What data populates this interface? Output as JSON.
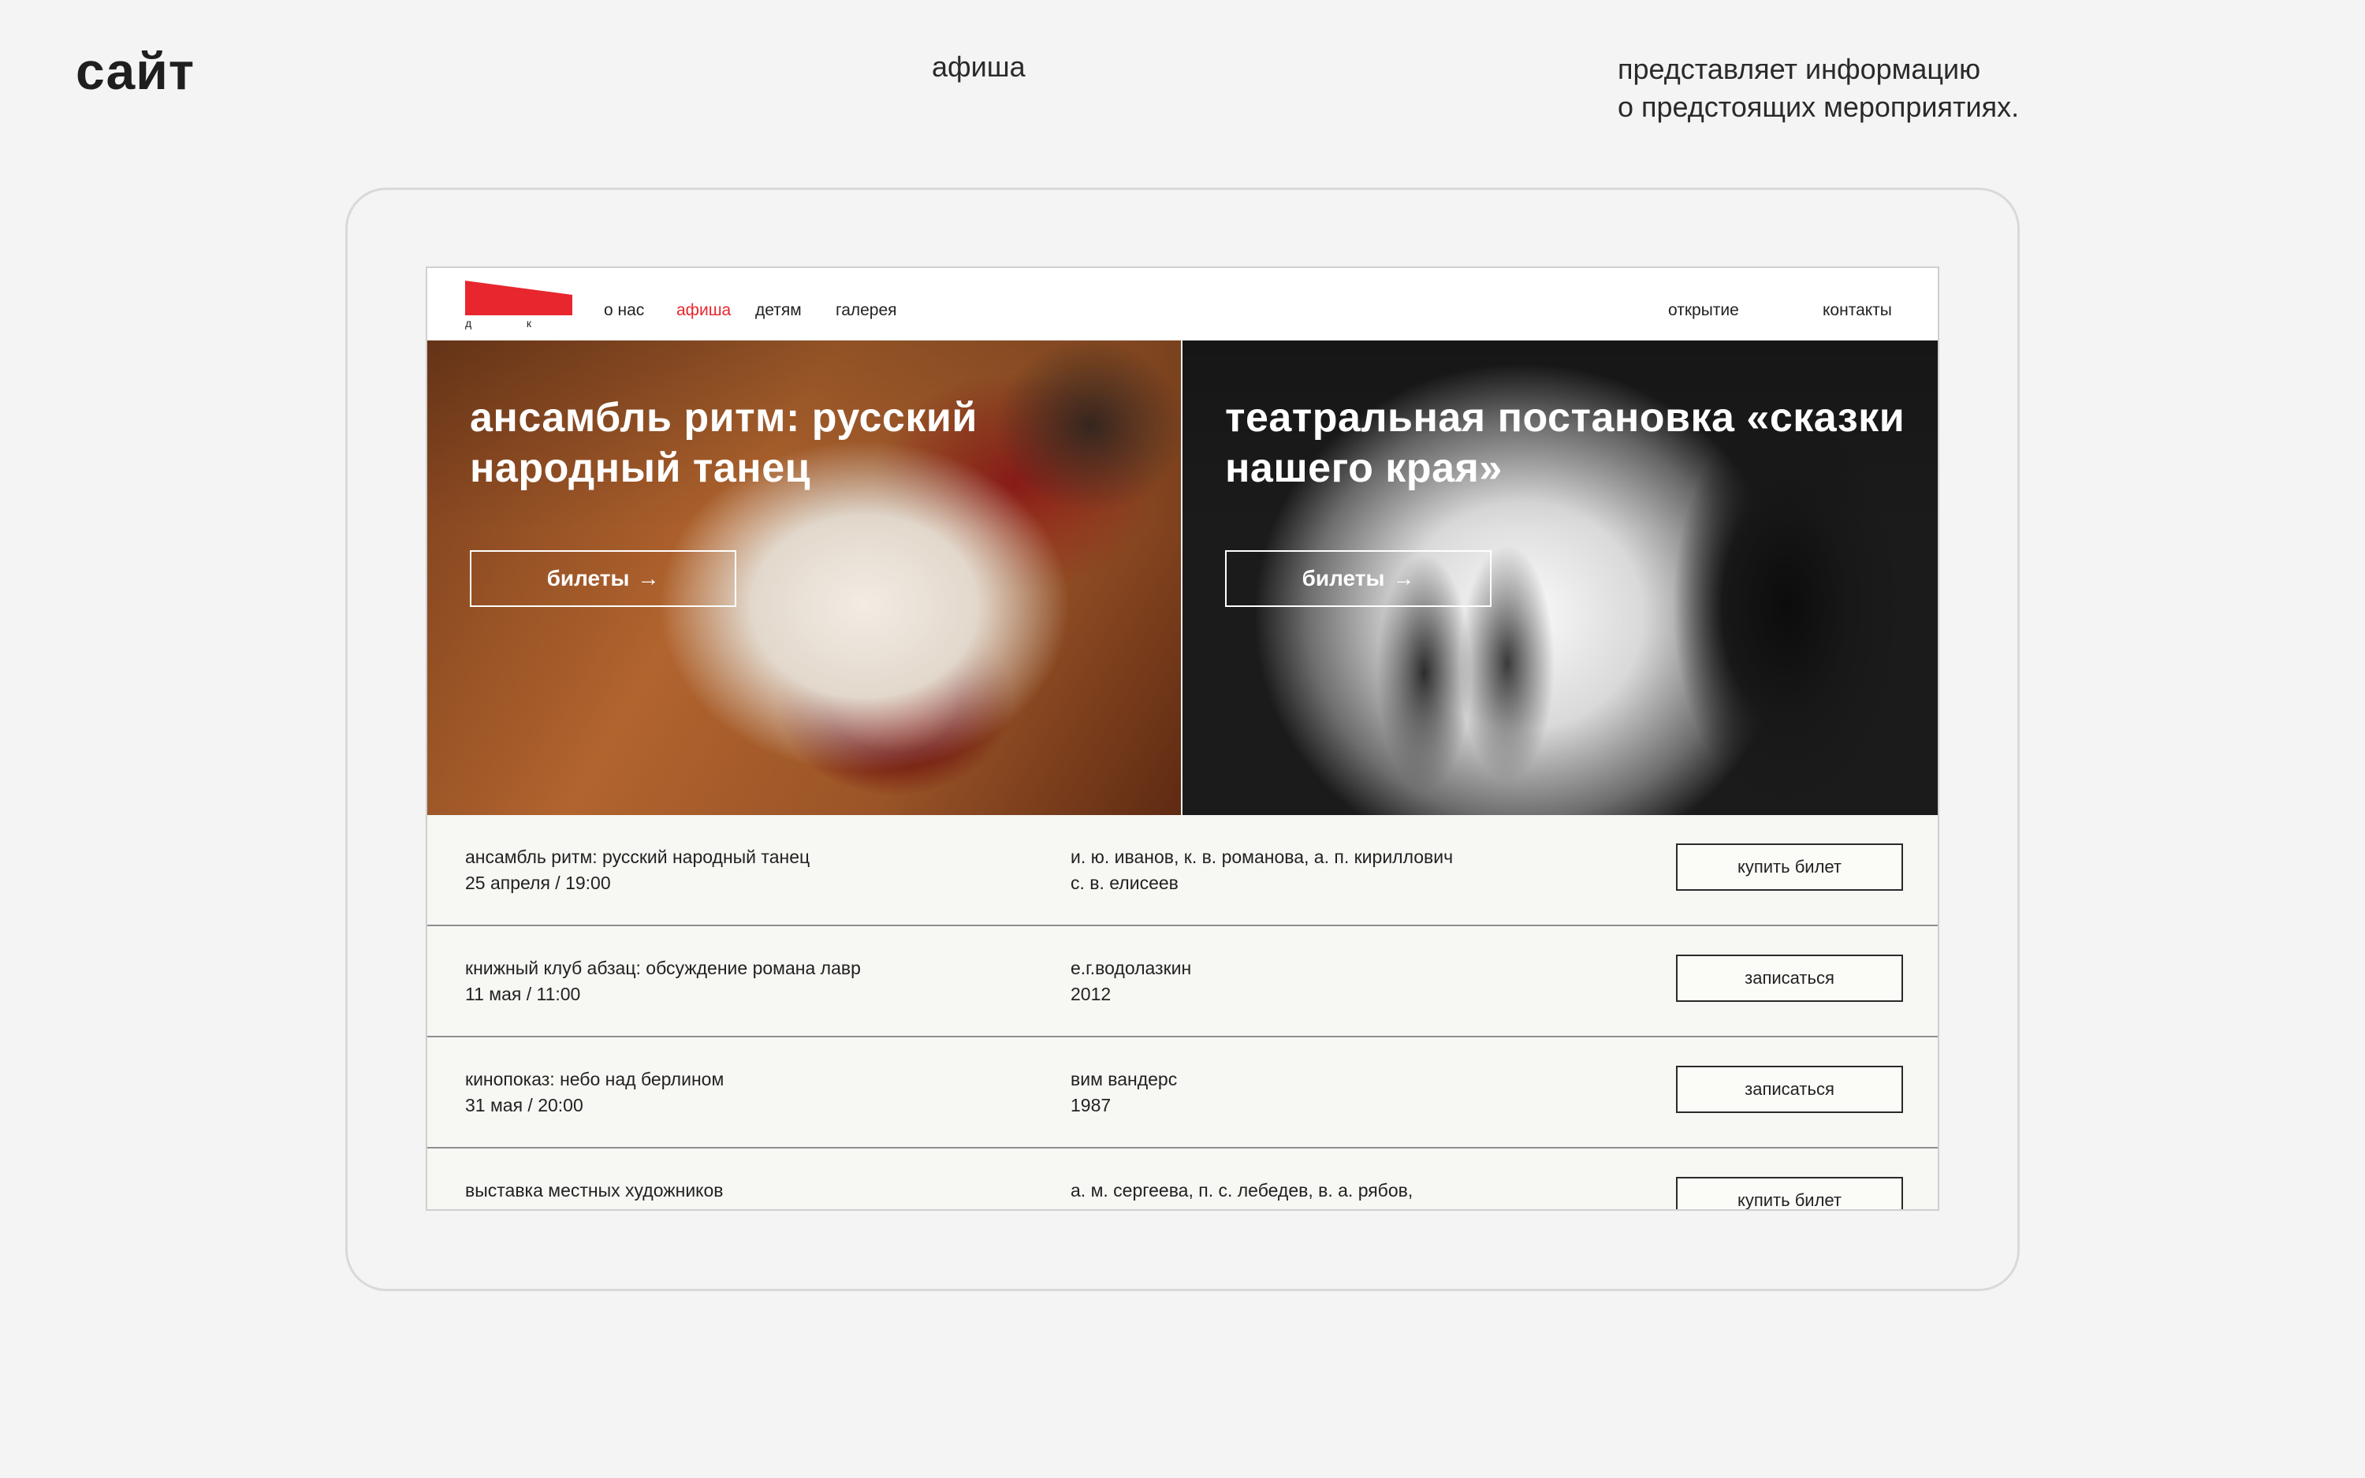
{
  "presentation": {
    "title": "сайт",
    "section": "афиша",
    "description_line1": "представляет информацию",
    "description_line2": "о предстоящих мероприятиях."
  },
  "site": {
    "logo": {
      "letter1": "д",
      "letter2": "к",
      "color": "#e8262d"
    },
    "nav": {
      "about": "о нас",
      "afisha": "афиша",
      "kids": "детям",
      "gallery": "галерея",
      "opening": "открытие",
      "contacts": "контакты"
    },
    "accent_color": "#e8262d",
    "hero": [
      {
        "title_line1": "ансамбль ритм: русский",
        "title_line2": "народный танец",
        "button": "билеты",
        "arrow": "→"
      },
      {
        "title_line1": "театральная постановка «сказки",
        "title_line2": "нашего края»",
        "button": "билеты",
        "arrow": "→"
      }
    ],
    "events": [
      {
        "title": "ансамбль ритм: русский народный танец",
        "date": "25 апреля / 19:00",
        "people": "и. ю. иванов,  к. в. романова,  а. п. кириллович",
        "extra": "с. в. елисеев",
        "button": "купить билет"
      },
      {
        "title": "книжный клуб абзац: обсуждение романа лавр",
        "date": "11 мая / 11:00",
        "people": "е.г.водолазкин",
        "extra": "2012",
        "button": "записаться"
      },
      {
        "title": "кинопоказ: небо над берлином",
        "date": "31 мая / 20:00",
        "people": "вим вандерс",
        "extra": "1987",
        "button": "записаться"
      },
      {
        "title": "выставка местных художников",
        "people": "а. м. сергеева,  п. с. лебедев,  в. а. рябов,",
        "button": "купить билет"
      }
    ]
  }
}
